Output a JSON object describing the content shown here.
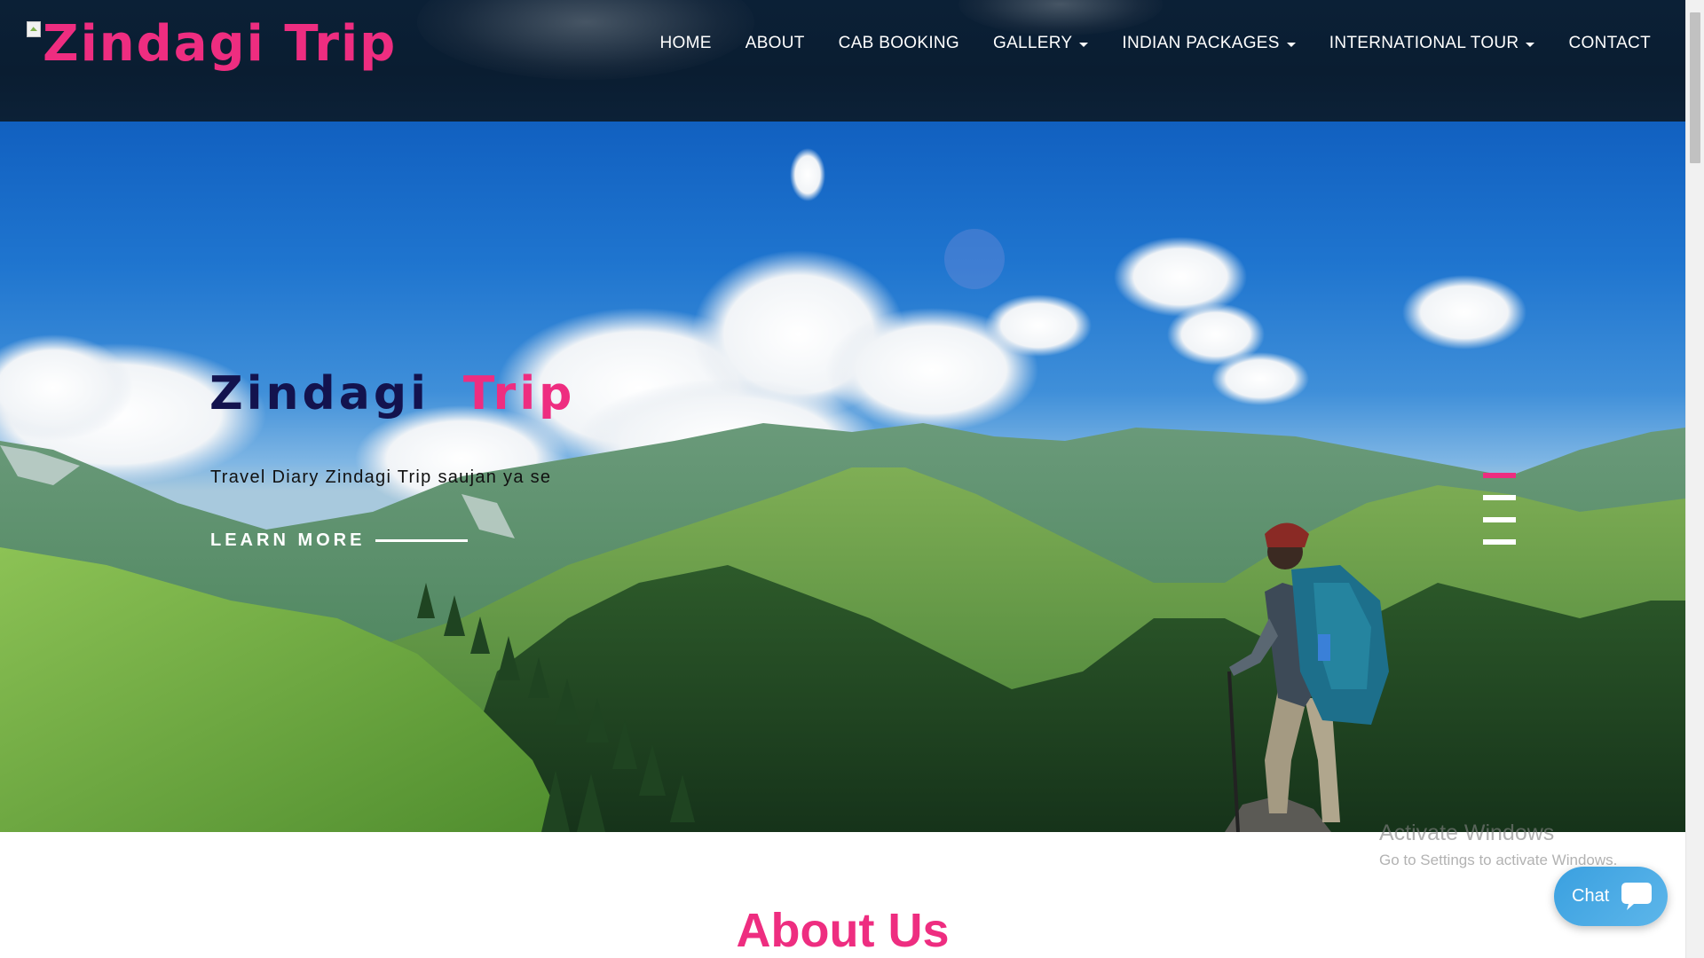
{
  "header": {
    "logo_text": "Zindagi Trip",
    "nav": [
      {
        "label": "HOME",
        "dropdown": false
      },
      {
        "label": "ABOUT",
        "dropdown": false
      },
      {
        "label": "CAB BOOKING",
        "dropdown": false
      },
      {
        "label": "GALLERY",
        "dropdown": true
      },
      {
        "label": "INDIAN PACKAGES",
        "dropdown": true
      },
      {
        "label": "INTERNATIONAL TOUR",
        "dropdown": true
      },
      {
        "label": "CONTACT",
        "dropdown": false
      }
    ]
  },
  "hero": {
    "title_part1": "Zindagi",
    "title_part2": "Trip",
    "subtitle": "Travel Diary Zindagi Trip saujan ya se",
    "cta_label": "LEARN MORE",
    "slides_count": 4,
    "active_slide": 1
  },
  "about": {
    "title": "About Us"
  },
  "watermark": {
    "line1": "Activate Windows",
    "line2": "Go to Settings to activate Windows."
  },
  "chat": {
    "label": "Chat"
  },
  "colors": {
    "accent": "#ee2d80",
    "header_bg": "#0b2036",
    "title_dark": "#13134e"
  }
}
